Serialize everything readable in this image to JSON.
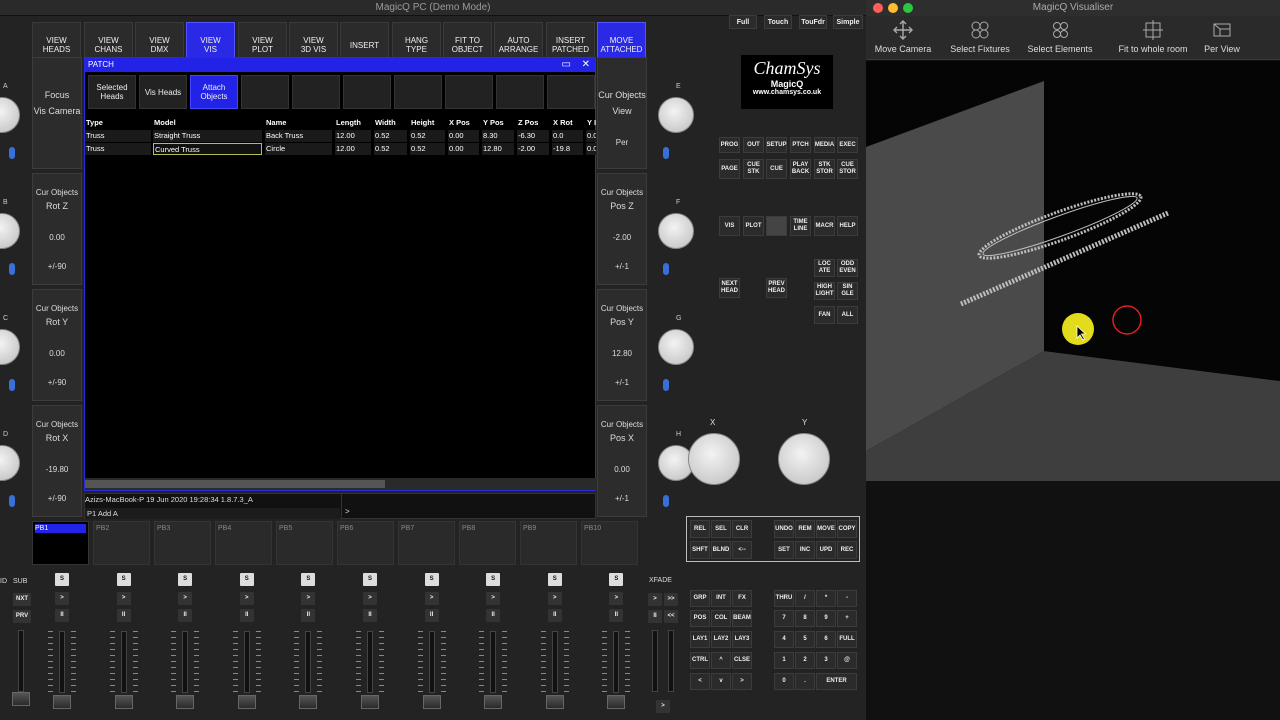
{
  "main_window": {
    "title": "MagicQ PC (Demo Mode)"
  },
  "vis_window": {
    "title": "MagicQ Visualiser"
  },
  "toolbar": [
    {
      "label": "VIEW\nHEADS",
      "active": false
    },
    {
      "label": "VIEW\nCHANS",
      "active": false
    },
    {
      "label": "VIEW\nDMX",
      "active": false
    },
    {
      "label": "VIEW\nVIS",
      "active": true
    },
    {
      "label": "VIEW\nPLOT",
      "active": false
    },
    {
      "label": "VIEW\n3D VIS",
      "active": false
    },
    {
      "label": "INSERT",
      "active": false
    },
    {
      "label": "HANG\nTYPE",
      "active": false
    },
    {
      "label": "FIT TO\nOBJECT",
      "active": false
    },
    {
      "label": "AUTO\nARRANGE",
      "active": false
    },
    {
      "label": "INSERT\nPATCHED",
      "active": false
    },
    {
      "label": "MOVE\nATTACHED",
      "active": true
    }
  ],
  "view_modes": [
    "Full",
    "Touch",
    "TouFdr",
    "Simple"
  ],
  "left_encoders": [
    {
      "letter": "A",
      "line1": "Focus",
      "line2": "Vis Camera",
      "value": "",
      "step": ""
    },
    {
      "letter": "B",
      "line1": "Cur Objects",
      "line2": "Rot Z",
      "value": "0.00",
      "step": "+/-90"
    },
    {
      "letter": "C",
      "line1": "Cur Objects",
      "line2": "Rot Y",
      "value": "0.00",
      "step": "+/-90"
    },
    {
      "letter": "D",
      "line1": "Cur Objects",
      "line2": "Rot X",
      "value": "-19.80",
      "step": "+/-90"
    }
  ],
  "right_encoders": [
    {
      "letter": "E",
      "line1": "Cur Objects",
      "line2": "View",
      "value": "Per",
      "step": ""
    },
    {
      "letter": "F",
      "line1": "Cur Objects",
      "line2": "Pos Z",
      "value": "-2.00",
      "step": "+/-1"
    },
    {
      "letter": "G",
      "line1": "Cur Objects",
      "line2": "Pos Y",
      "value": "12.80",
      "step": "+/-1"
    },
    {
      "letter": "H",
      "line1": "Cur Objects",
      "line2": "Pos X",
      "value": "0.00",
      "step": "+/-1"
    }
  ],
  "patch": {
    "title": "PATCH",
    "buttons": [
      "Selected\nHeads",
      "Vis Heads",
      "Attach\nObjects",
      "",
      "",
      "",
      "",
      "",
      "",
      ""
    ],
    "columns": [
      "Type",
      "Model",
      "Name",
      "Length",
      "Width",
      "Height",
      "X Pos",
      "Y Pos",
      "Z Pos",
      "X Rot",
      "Y I"
    ],
    "rows": [
      [
        "Truss",
        "Straight Truss",
        "Back Truss",
        "12.00",
        "0.52",
        "0.52",
        "0.00",
        "8.30",
        "-6.30",
        "0.0",
        "0.0"
      ],
      [
        "Truss",
        "Curved Truss",
        "Circle",
        "12.00",
        "0.52",
        "0.52",
        "0.00",
        "12.80",
        "-2.00",
        "-19.8",
        "0.0"
      ]
    ],
    "status": "Azizs-MacBook-P 19 Jun 2020 19:28:34 1.8.7.3_A",
    "cmdline": "P1  Add A",
    "prompt": ">"
  },
  "logo": {
    "brand": "ChamSys",
    "product": "MagicQ",
    "url": "www.chamsys.co.uk"
  },
  "keys_row1": [
    "PROG",
    "OUT",
    "SETUP",
    "PTCH",
    "MEDIA",
    "EXEC"
  ],
  "keys_row2": [
    "PAGE",
    "CUE\nSTK",
    "CUE",
    "PLAY\nBACK",
    "STK\nSTOR",
    "CUE\nSTOR"
  ],
  "keys_row3": [
    "VIS",
    "PLOT",
    "",
    "TIME\nLINE",
    "MACR",
    "HELP"
  ],
  "head_keys": [
    "NEXT\nHEAD",
    "PREV\nHEAD"
  ],
  "sel_keys": [
    "LOC\nATE",
    "ODD\nEVEN",
    "HIGH\nLIGHT",
    "SIN\nGLE",
    "FAN",
    "ALL"
  ],
  "xy_labels": [
    "X",
    "Y"
  ],
  "rel_keys": [
    "REL",
    "SEL",
    "CLR",
    "SHFT",
    "BLND",
    "<--"
  ],
  "undo_keys": [
    "UNDO",
    "REM",
    "MOVE",
    "COPY",
    "SET",
    "INC",
    "UPD",
    "REC"
  ],
  "attr_keys": [
    "GRP",
    "INT",
    "FX",
    "POS",
    "COL",
    "BEAM",
    "LAY1",
    "LAY2",
    "LAY3",
    "CTRL",
    "^",
    "CLSE",
    "<",
    "v",
    ">"
  ],
  "num_keys": [
    "THRU",
    "/",
    "*",
    "-",
    "7",
    "8",
    "9",
    "+",
    "4",
    "5",
    "6",
    "FULL",
    "1",
    "2",
    "3",
    "@",
    "0",
    ".",
    "ENTER"
  ],
  "playbacks": [
    "PB1",
    "PB2",
    "PB3",
    "PB4",
    "PB5",
    "PB6",
    "PB7",
    "PB8",
    "PB9",
    "PB10"
  ],
  "fader_side": {
    "id": "ID",
    "sub": "SUB",
    "nxt": "NXT",
    "prv": "PRV"
  },
  "fader_btns": {
    "s": "S",
    "go": ">",
    "pause": "II"
  },
  "xfade": {
    "label": "XFADE",
    "b1": ">",
    "b2": ">>",
    "b3": "II",
    "b4": "<<",
    "b5": ">"
  },
  "vis_tools": [
    "Move Camera",
    "Select Fixtures",
    "Select Elements",
    "Fit to whole room",
    "Per View"
  ]
}
